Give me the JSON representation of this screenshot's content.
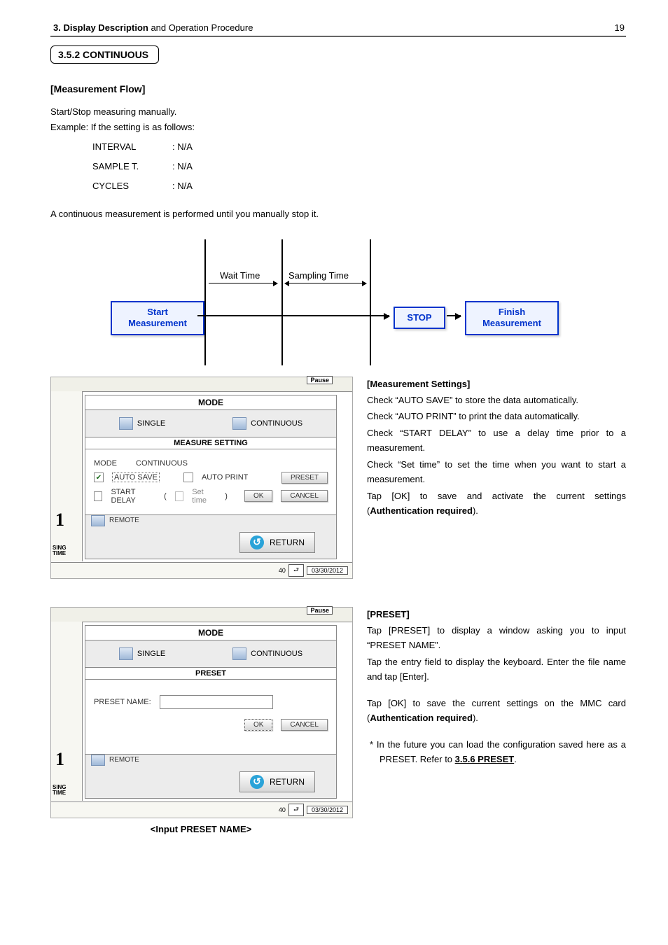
{
  "header": {
    "title_bold": "3. Display Description",
    "title_rest": " and Operation Procedure",
    "page_num": "19"
  },
  "section_num": "3.5.2 CONTINUOUS",
  "flow_heading": "[Measurement Flow]",
  "intro1": "Start/Stop measuring manually.",
  "intro2": "Example: If the setting is as follows:",
  "settings_rows": [
    {
      "k": "INTERVAL",
      "v": ": N/A"
    },
    {
      "k": "SAMPLE T.",
      "v": ": N/A"
    },
    {
      "k": "CYCLES",
      "v": ": N/A"
    }
  ],
  "cont_line": "A continuous measurement is performed until you manually stop it.",
  "flow": {
    "wait": "Wait Time",
    "sampling": "Sampling Time",
    "start": "Start\nMeasurement",
    "stop": "STOP",
    "finish": "Finish\nMeasurement"
  },
  "dlg": {
    "pause": "Pause",
    "mode": "MODE",
    "single": "SINGLE",
    "continuous": "CONTINUOUS",
    "measure_setting": "MEASURE SETTING",
    "mode_label": "MODE",
    "mode_val": "CONTINUOUS",
    "auto_save": "AUTO SAVE",
    "auto_print": "AUTO PRINT",
    "preset_btn": "PRESET",
    "start_delay": "START DELAY",
    "set_time": "Set time",
    "ok": "OK",
    "cancel": "CANCEL",
    "remote": "REMOTE",
    "return": "RETURN",
    "preset_head": "PRESET",
    "preset_name": "PRESET NAME:",
    "strip_one": "1",
    "strip_sing": "SING",
    "strip_time": "TIME",
    "date_num": "40",
    "date": "03/30/2012"
  },
  "ms": {
    "h": "[Measurement Settings]",
    "l1": "Check “AUTO SAVE” to store the data automatically.",
    "l2": "Check “AUTO PRINT” to print the data automatically.",
    "l3": "Check “START DELAY” to use a delay time prior to a measurement.",
    "l4": "Check “Set time” to set the time when you want to start a measurement.",
    "l5a": "Tap [OK] to save and activate the current settings (",
    "l5b": "Authentication required",
    "l5c": ")."
  },
  "ps": {
    "h": "[PRESET]",
    "l1": "Tap [PRESET] to display a window asking you to input “PRESET NAME”.",
    "l2": "Tap the entry field to display the keyboard. Enter the file name and tap [Enter].",
    "l3a": "Tap [OK] to save the current settings on the MMC card (",
    "l3b": "Authentication required",
    "l3c": ").",
    "note_a": "* In the future you can load the configuration saved here as a PRESET. Refer to ",
    "ref": "3.5.6 PRESET",
    "note_b": "."
  },
  "caption": "<Input PRESET NAME>"
}
